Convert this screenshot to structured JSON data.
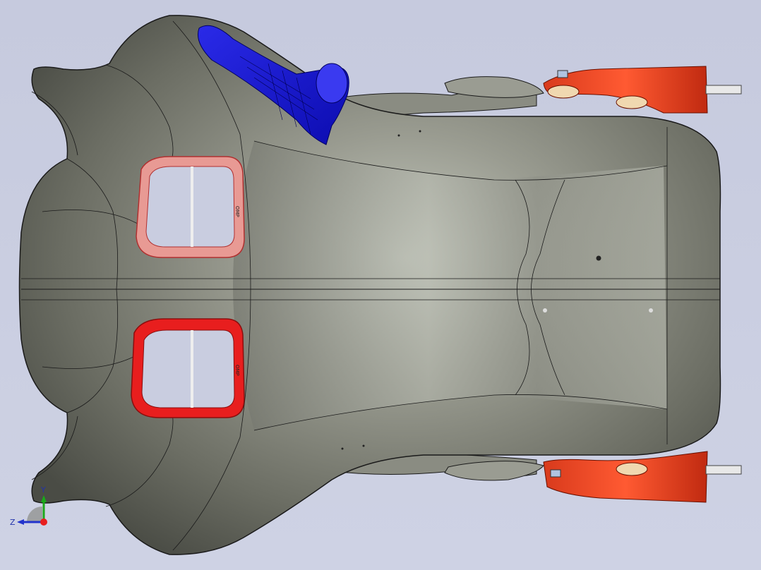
{
  "viewport": {
    "background": "#c9cde0",
    "model_color": "#7c7e74",
    "edge_color": "#1a1a1a",
    "highlight_red": "#e81e1e",
    "selection_blue": "#1414e6",
    "bracket_orange": "#f04a28"
  },
  "seat_labels": {
    "left_upper": "OMP",
    "left_lower": "OMP"
  },
  "triad": {
    "y_label": "Y",
    "z_label": "Z"
  }
}
